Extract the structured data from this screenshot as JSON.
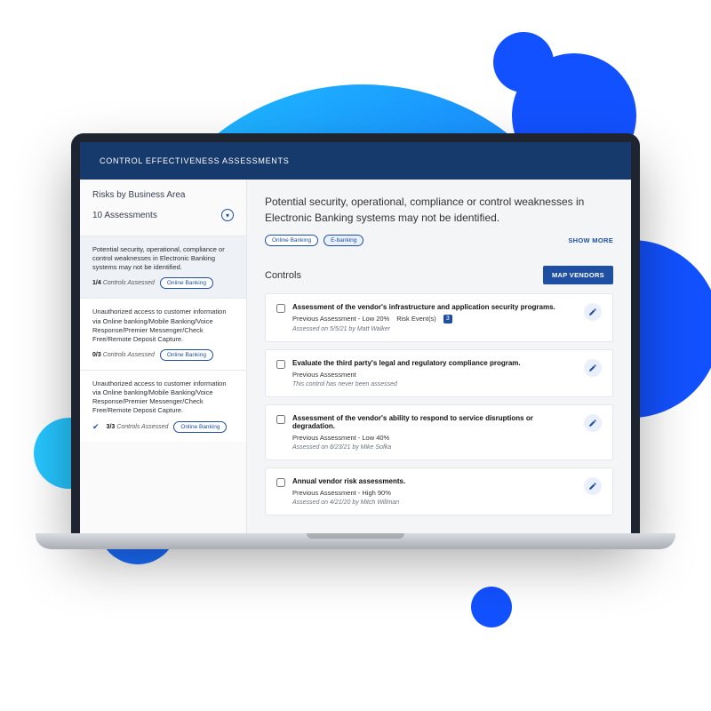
{
  "header": {
    "title": "CONTROL EFFECTIVENESS ASSESSMENTS"
  },
  "sidebar": {
    "title": "Risks by Business Area",
    "count_label": "10 Assessments",
    "filter_icon": "▾",
    "items": [
      {
        "text": "Potential security, operational, compliance or control weaknesses in Electronic Banking systems may not be identified.",
        "ratio": "1/4",
        "ratio_label": "Controls Assessed",
        "tag": "Online Banking",
        "checked": false
      },
      {
        "text": "Unauthorized access to customer information via Online banking/Mobile Banking/Voice Response/Premier Messenger/Check Free/Remote Deposit Capture.",
        "ratio": "0/3",
        "ratio_label": "Controls Assessed",
        "tag": "Online Banking",
        "checked": false
      },
      {
        "text": "Unauthorized access to customer information via Online banking/Mobile Banking/Voice Response/Premier Messenger/Check Free/Remote Deposit Capture.",
        "ratio": "3/3",
        "ratio_label": "Controls Assessed",
        "tag": "Online Banking",
        "checked": true
      }
    ]
  },
  "main": {
    "heading": "Potential security, operational, compliance or control weaknesses in Electronic Banking systems may not be identified.",
    "tags": [
      {
        "label": "Online Banking",
        "filled": false
      },
      {
        "label": "E-banking",
        "filled": true
      }
    ],
    "show_more": "SHOW MORE",
    "controls_heading": "Controls",
    "map_vendors": "MAP VENDORS",
    "controls": [
      {
        "title": "Assessment of the vendor's infrastructure and application security programs.",
        "prev_label": "Previous Assessment - Low 20%",
        "risk_label": "Risk Event(s)",
        "risk_count": "3",
        "sub": "Assessed on 5/5/21 by Matt Walker"
      },
      {
        "title": "Evaluate the third party's legal and regulatory compliance program.",
        "prev_label": "Previous Assessment",
        "risk_label": "",
        "risk_count": "",
        "sub": "This control has never been assessed"
      },
      {
        "title": "Assessment of the vendor's ability to respond to service disruptions or degradation.",
        "prev_label": "Previous Assessment - Low 40%",
        "risk_label": "",
        "risk_count": "",
        "sub": "Assessed on 8/23/21 by Mike Sofka"
      },
      {
        "title": "Annual vendor risk assessments.",
        "prev_label": "Previous Assessment - High 90%",
        "risk_label": "",
        "risk_count": "",
        "sub": "Assessed on 4/21/20 by Mitch Willman"
      }
    ]
  }
}
